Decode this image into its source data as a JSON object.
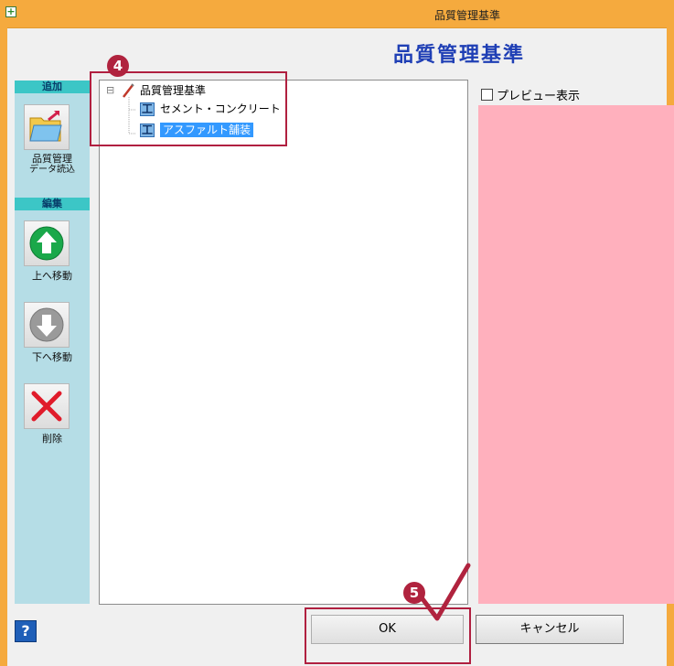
{
  "window": {
    "title": "品質管理基準"
  },
  "header": {
    "title": "品質管理基準"
  },
  "toolbar": {
    "add_section": "追加",
    "edit_section": "編集",
    "import_label_1": "品質管理",
    "import_label_2": "データ読込",
    "move_up_label": "上へ移動",
    "move_down_label": "下へ移動",
    "delete_label": "削除"
  },
  "tree": {
    "expander": "⊟",
    "root": "品質管理基準",
    "badge": "工",
    "items": [
      {
        "label": "セメント・コンクリート"
      },
      {
        "label": "アスファルト舗装",
        "selected": true
      }
    ]
  },
  "preview": {
    "label": "プレビュー表示",
    "checked": false
  },
  "buttons": {
    "help": "?",
    "ok": "OK",
    "cancel": "キャンセル"
  },
  "annotations": {
    "step4": "4",
    "step5": "5"
  },
  "colors": {
    "title_bar": "#f5aa3e",
    "header_title": "#1f3fb5",
    "preview": "#ffb0bd",
    "callout": "#b02040"
  }
}
